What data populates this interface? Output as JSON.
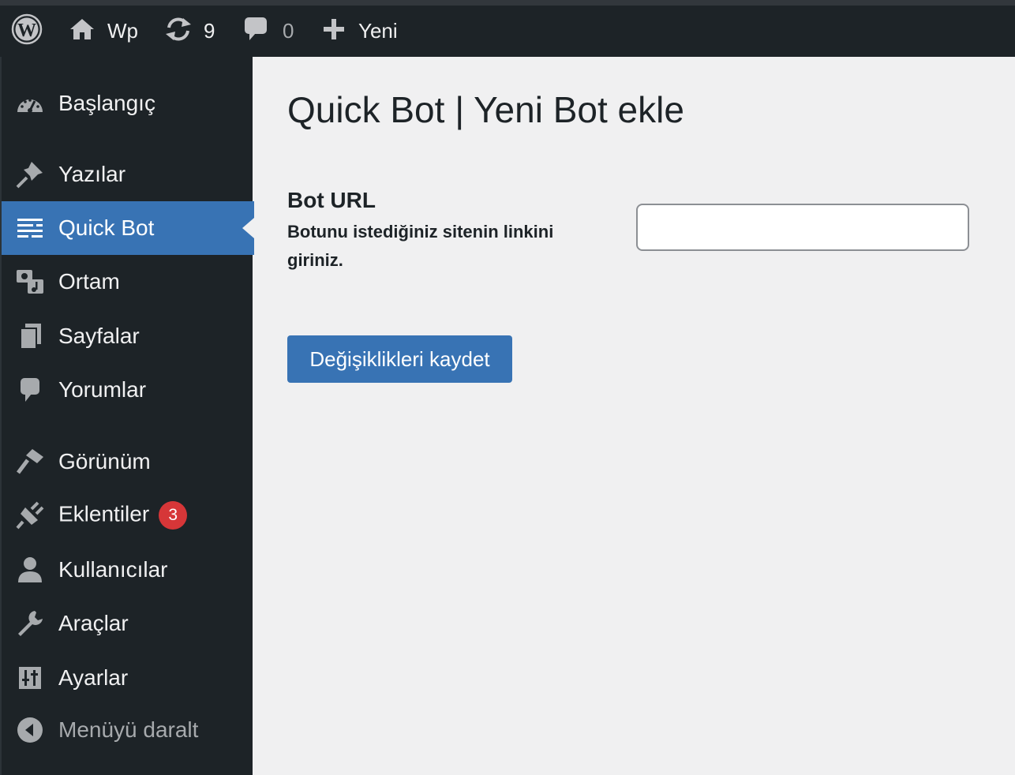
{
  "adminbar": {
    "site_name": "Wp",
    "updates_count": "9",
    "comments_count": "0",
    "new_label": "Yeni"
  },
  "sidebar": {
    "items": [
      {
        "label": "Başlangıç",
        "icon": "dashboard-icon"
      },
      {
        "label": "Yazılar",
        "icon": "pin-icon"
      },
      {
        "label": "Quick Bot",
        "icon": "text-lines-icon",
        "current": true
      },
      {
        "label": "Ortam",
        "icon": "media-icon"
      },
      {
        "label": "Sayfalar",
        "icon": "pages-icon"
      },
      {
        "label": "Yorumlar",
        "icon": "comment-icon"
      },
      {
        "label": "Görünüm",
        "icon": "brush-icon"
      },
      {
        "label": "Eklentiler",
        "icon": "plugin-icon",
        "badge": "3"
      },
      {
        "label": "Kullanıcılar",
        "icon": "user-icon"
      },
      {
        "label": "Araçlar",
        "icon": "wrench-icon"
      },
      {
        "label": "Ayarlar",
        "icon": "settings-sliders-icon"
      }
    ],
    "collapse_label": "Menüyü daralt"
  },
  "main": {
    "title": "Quick Bot | Yeni Bot ekle",
    "field_label": "Bot URL",
    "field_description": "Botunu istediğiniz sitenin linkini giriniz.",
    "field_value": "",
    "save_label": "Değişiklikleri kaydet"
  },
  "colors": {
    "accent": "#3873b4",
    "sidebar_bg": "#1d2327",
    "badge": "#d63638",
    "content_bg": "#f0f0f1"
  }
}
